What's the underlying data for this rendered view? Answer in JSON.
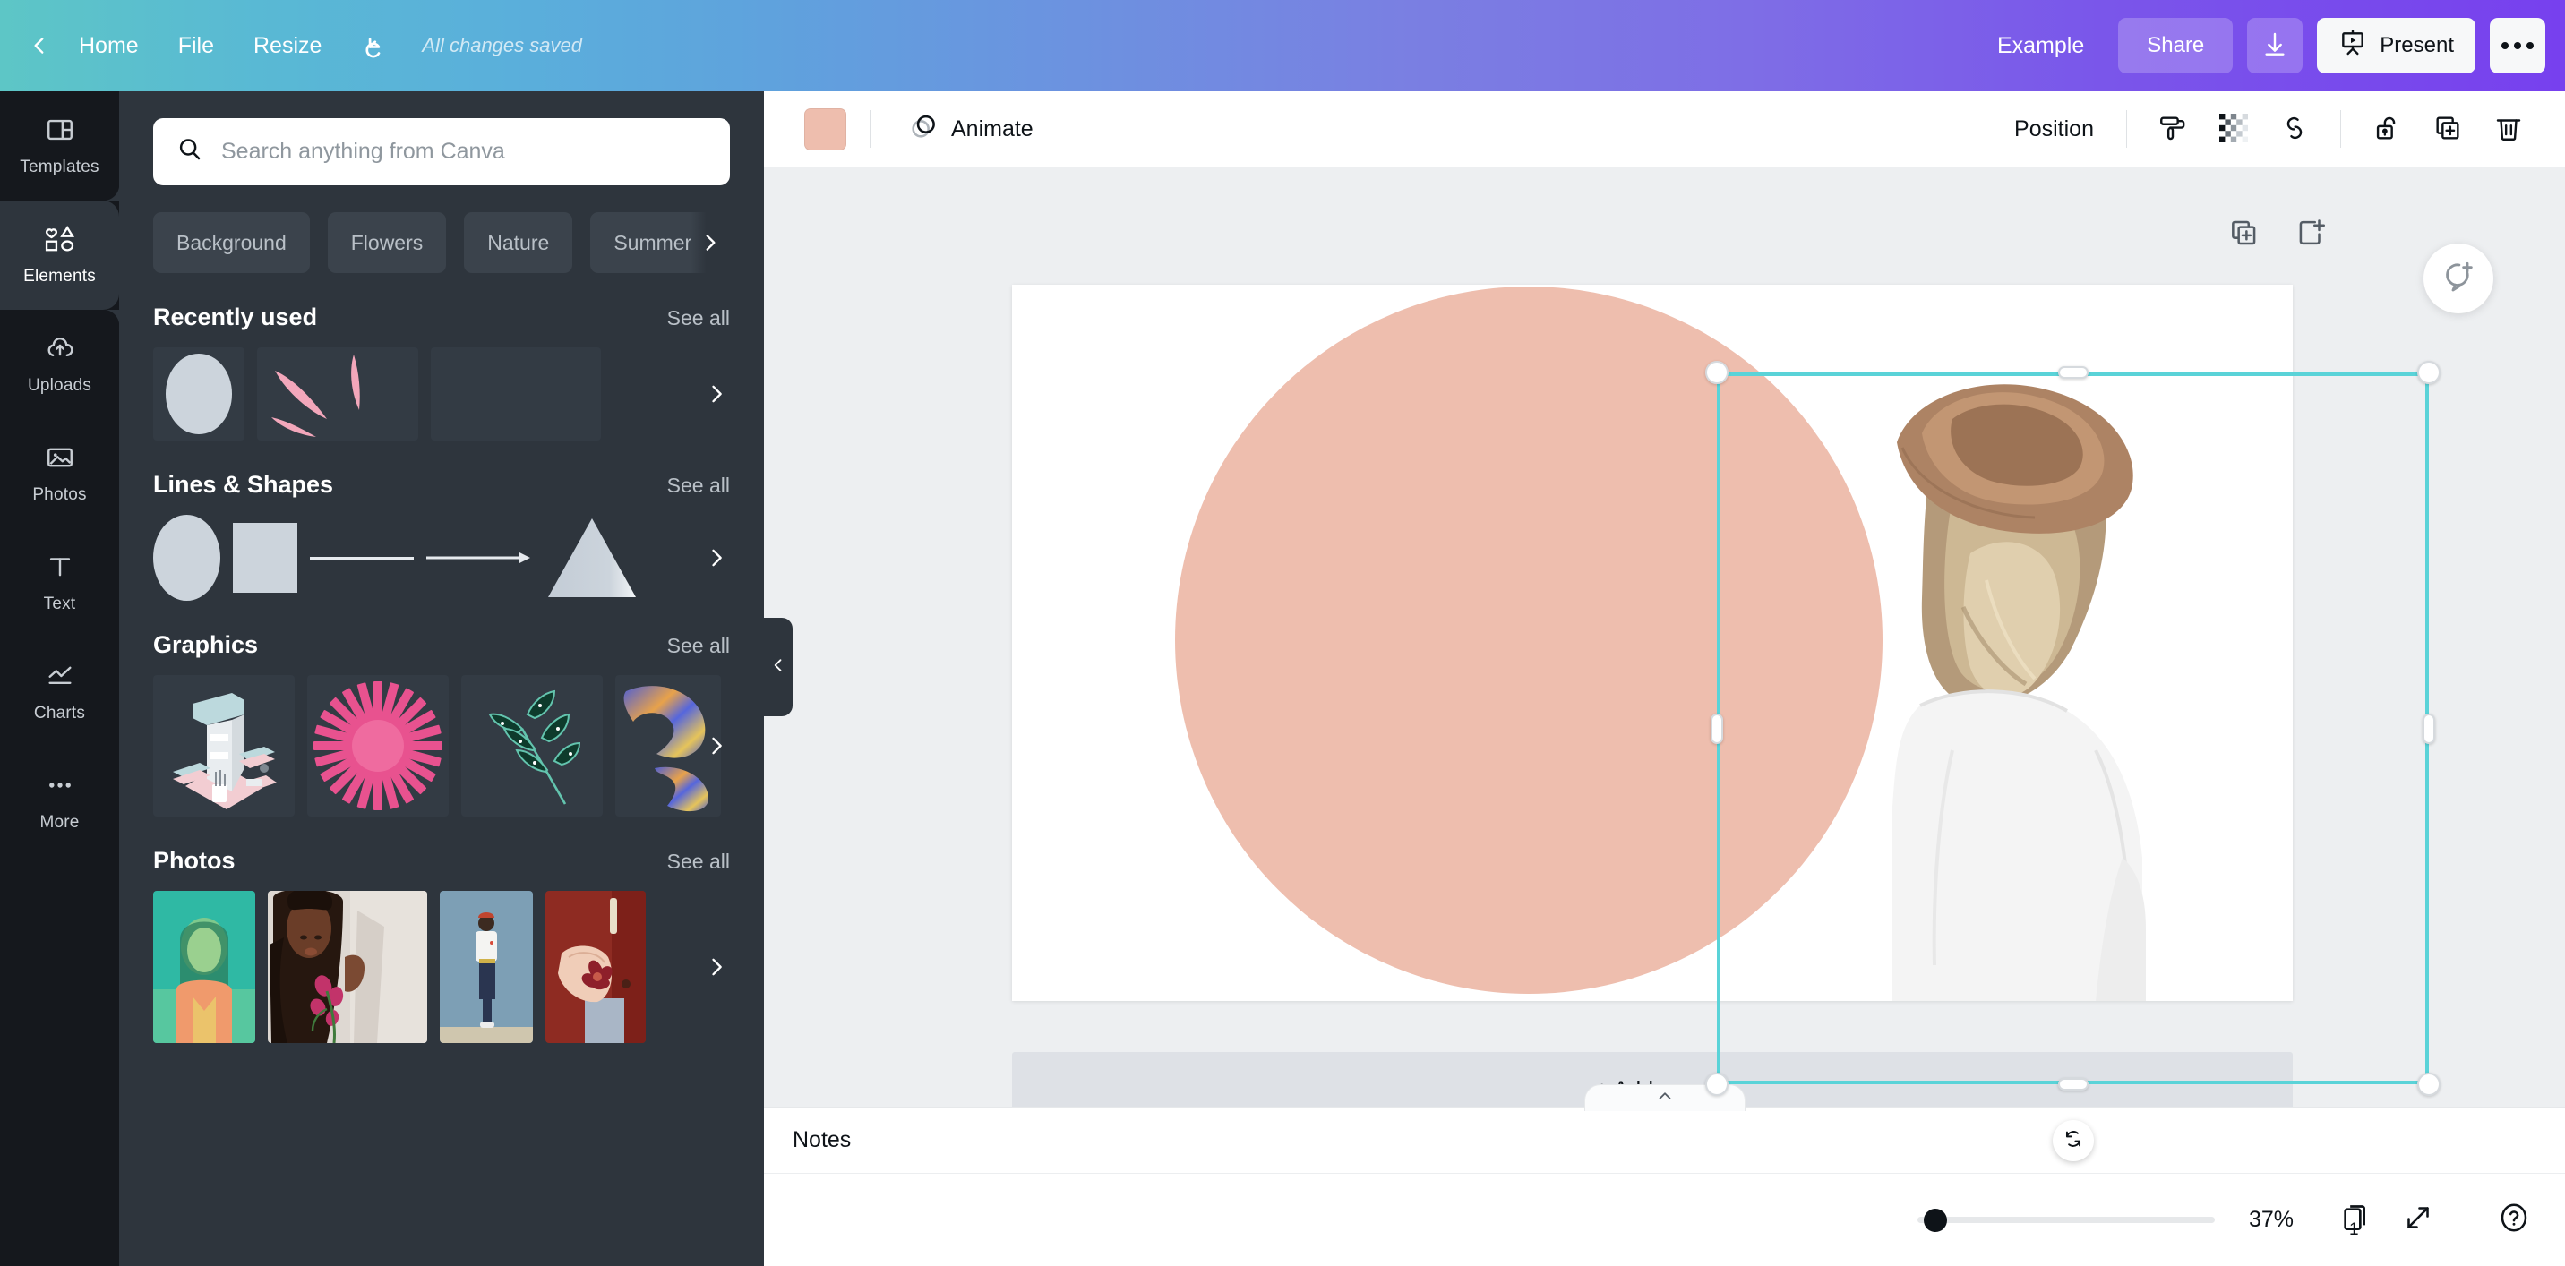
{
  "header": {
    "back_icon": "chevron-left-icon",
    "menu": [
      {
        "label": "Home"
      },
      {
        "label": "File"
      },
      {
        "label": "Resize"
      }
    ],
    "undo_icon": "undo-icon",
    "save_status": "All changes saved",
    "doc_title": "Example",
    "share_label": "Share",
    "download_icon": "download-icon",
    "present_label": "Present",
    "present_icon": "present-screen-icon",
    "more_icon": "ellipsis-icon",
    "gradient_start": "#5dc6c6",
    "gradient_end": "#7740ee"
  },
  "rail": {
    "items": [
      {
        "label": "Templates",
        "icon": "templates-icon",
        "active": false
      },
      {
        "label": "Elements",
        "icon": "elements-icon",
        "active": true
      },
      {
        "label": "Uploads",
        "icon": "cloud-upload-icon",
        "active": false
      },
      {
        "label": "Photos",
        "icon": "photo-icon",
        "active": false
      },
      {
        "label": "Text",
        "icon": "text-icon",
        "active": false
      },
      {
        "label": "Charts",
        "icon": "chart-line-icon",
        "active": false
      },
      {
        "label": "More",
        "icon": "ellipsis-icon",
        "active": false
      }
    ]
  },
  "panel": {
    "search": {
      "placeholder": "Search anything from Canva",
      "value": "",
      "icon": "search-icon"
    },
    "chips": [
      "Background",
      "Flowers",
      "Nature",
      "Summer"
    ],
    "chips_next_icon": "chevron-right-icon",
    "sections": [
      {
        "title": "Recently used",
        "see_all": "See all",
        "next_icon": "chevron-right-icon",
        "items": [
          {
            "name": "gray-circle-shape"
          },
          {
            "name": "pink-petals-graphic"
          },
          {
            "name": "empty-tile"
          }
        ]
      },
      {
        "title": "Lines & Shapes",
        "see_all": "See all",
        "next_icon": "chevron-right-icon",
        "items": [
          {
            "name": "circle-shape"
          },
          {
            "name": "square-shape"
          },
          {
            "name": "line-shape"
          },
          {
            "name": "arrow-shape"
          },
          {
            "name": "triangle-shape"
          }
        ]
      },
      {
        "title": "Graphics",
        "see_all": "See all",
        "next_icon": "chevron-right-icon",
        "items": [
          {
            "name": "isometric-number-one-graphic"
          },
          {
            "name": "pink-sunburst-graphic"
          },
          {
            "name": "green-botanical-branch-graphic"
          },
          {
            "name": "blue-striped-shell-graphic"
          }
        ]
      },
      {
        "title": "Photos",
        "see_all": "See all",
        "next_icon": "chevron-right-icon",
        "items": [
          {
            "name": "photo-teal-portrait"
          },
          {
            "name": "photo-woman-with-flowers"
          },
          {
            "name": "photo-person-blue-wall"
          },
          {
            "name": "photo-hands-red-flower"
          }
        ]
      }
    ],
    "collapse_icon": "chevron-left-icon"
  },
  "context_toolbar": {
    "color_swatch": "#eebeae",
    "animate_label": "Animate",
    "animate_icon": "animate-circles-icon",
    "position_label": "Position",
    "tools": [
      {
        "name": "paint-roller-icon"
      },
      {
        "name": "transparency-icon"
      },
      {
        "name": "link-icon"
      },
      {
        "name": "unlock-icon"
      },
      {
        "name": "duplicate-icon"
      },
      {
        "name": "trash-icon"
      }
    ]
  },
  "canvas": {
    "page_actions": [
      {
        "name": "duplicate-page-icon"
      },
      {
        "name": "add-page-icon"
      }
    ],
    "comment_fab_icon": "add-comment-icon",
    "shape_color": "#eebeae",
    "selection_color": "#5ad3d8",
    "rotate_icon": "rotate-icon",
    "add_page_label": "+ Add page"
  },
  "notes": {
    "label": "Notes",
    "toggle_icon": "chevron-up-icon"
  },
  "statusbar": {
    "zoom_value": "37%",
    "zoom_percent": 2,
    "page_number": "1",
    "page_count_icon": "pages-icon",
    "fullscreen_icon": "expand-icon",
    "help_icon": "help-icon"
  }
}
